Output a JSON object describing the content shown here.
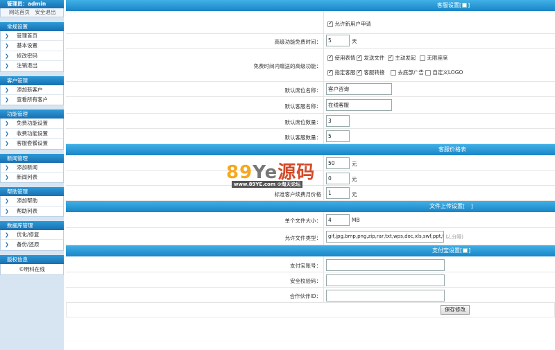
{
  "sidebar": {
    "admin_label": "管理员：admin",
    "top_links": [
      "网站首页",
      "安全退出"
    ],
    "groups": [
      {
        "title": "常规设置",
        "items": [
          "管理首页",
          "基本设置",
          "修改密码",
          "注销退出"
        ]
      },
      {
        "title": "客户管理",
        "items": [
          "添加新客户",
          "查看所有客户"
        ]
      },
      {
        "title": "功能管理",
        "items": [
          "免费功能设置",
          "收费功能设置",
          "客服套餐设置"
        ]
      },
      {
        "title": "新闻管理",
        "items": [
          "添加新闻",
          "新闻列表"
        ]
      },
      {
        "title": "帮助管理",
        "items": [
          "添加帮助",
          "帮助列表"
        ]
      },
      {
        "title": "数据库管理",
        "items": [
          "优化/修复",
          "备份/还原"
        ]
      },
      {
        "title": "版权信息",
        "items": []
      }
    ],
    "copyright": "©明科在线"
  },
  "sections": {
    "service": {
      "title": "客服设置[",
      "allow_register": "允许新用户申请",
      "free_time_label": "高级功能免费时间：",
      "free_time_value": "5",
      "free_time_unit": "天",
      "gift_label": "免费时间内赠送的高级功能：",
      "features": [
        {
          "label": "使用表情",
          "checked": true
        },
        {
          "label": "发送文件",
          "checked": true
        },
        {
          "label": "主动发起",
          "checked": true
        },
        {
          "label": "无限座席",
          "checked": false
        },
        {
          "label": "指定客服",
          "checked": true
        },
        {
          "label": "客服转接",
          "checked": true
        },
        {
          "label": "去底部广告",
          "checked": false
        },
        {
          "label": "自定义LOGO",
          "checked": false
        }
      ],
      "seat_name_label": "默认席位名称：",
      "seat_name_value": "客户咨询",
      "service_name_label": "默认客服名称：",
      "service_name_value": "在线客服",
      "seat_count_label": "默认席位数量：",
      "seat_count_value": "3",
      "service_count_label": "默认客服数量：",
      "service_count_value": "5"
    },
    "price": {
      "title": "客服价格表",
      "rows": [
        {
          "label": "",
          "value": "50",
          "unit": "元"
        },
        {
          "label": "",
          "value": "0",
          "unit": "元"
        },
        {
          "label": "标准客户续费月价格",
          "value": "1",
          "unit": "元"
        }
      ]
    },
    "upload": {
      "title": "文件上传设置[",
      "size_label": "单个文件大小：",
      "size_value": "4",
      "size_unit": "MB",
      "types_label": "允许文件类型：",
      "types_value": "gif,jpg,bmp,png,zip,rar,txt,wps,doc,xls,swf,ppt,fla,m",
      "types_hint": "以,分隔)"
    },
    "alipay": {
      "title": "支付宝设置[",
      "account_label": "支付宝账号：",
      "code_label": "安全校验码：",
      "partner_label": "合作伙伴ID：",
      "save_label": "保存修改"
    }
  },
  "watermark": {
    "logo": "89Ye源码",
    "url": "www.89YE.com",
    "tag": "⊙淘天论坛"
  }
}
